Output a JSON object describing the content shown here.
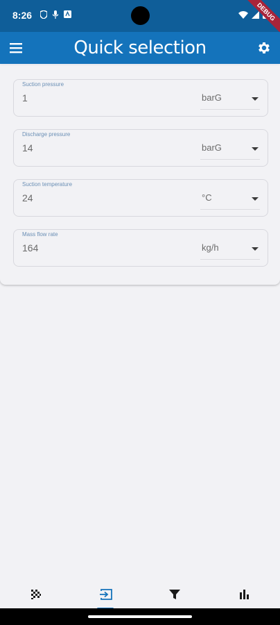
{
  "status_bar": {
    "time": "8:26"
  },
  "debug_banner": "DEBUG",
  "app_bar": {
    "title": "Quick selection"
  },
  "fields": [
    {
      "label": "Suction pressure",
      "value": "1",
      "unit": "barG"
    },
    {
      "label": "Discharge pressure",
      "value": "14",
      "unit": "barG"
    },
    {
      "label": "Suction temperature",
      "value": "24",
      "unit": "°C"
    },
    {
      "label": "Mass flow rate",
      "value": "164",
      "unit": "kg/h"
    }
  ],
  "bottom_nav": {
    "items": [
      {
        "icon": "checkered-flag-icon"
      },
      {
        "icon": "input-icon",
        "active": true
      },
      {
        "icon": "filter-icon"
      },
      {
        "icon": "bar-chart-icon"
      }
    ]
  },
  "colors": {
    "status_bar": "#0f5e99",
    "app_bar": "#1473bb",
    "background": "#f2f2f5",
    "accent": "#1473bb",
    "debug_banner": "#a8243a"
  }
}
